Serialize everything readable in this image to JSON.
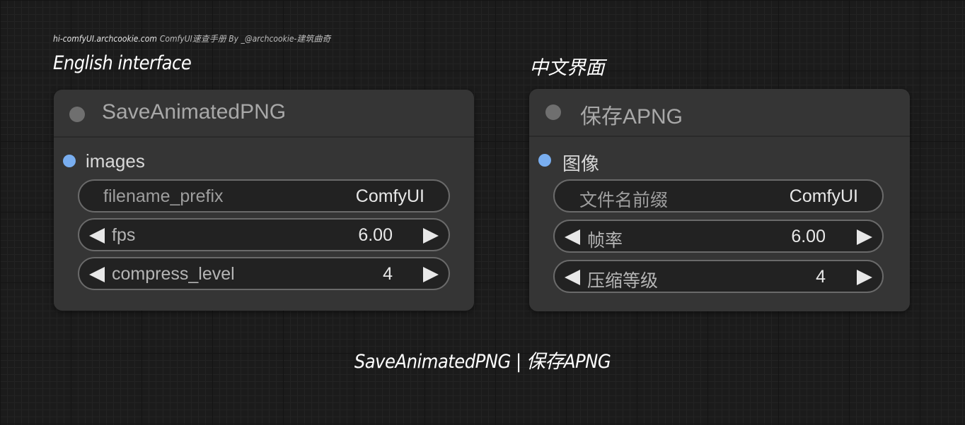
{
  "watermark": {
    "domain": "hi-comfyUI.archcookie.com",
    "text": "ComfyUI速查手册 By _@archcookie-建筑曲奇"
  },
  "sections": {
    "english_label": "English interface",
    "chinese_label": "中文界面"
  },
  "nodes": [
    {
      "title": "SaveAnimatedPNG",
      "input_label": "images",
      "widgets": [
        {
          "label": "filename_prefix",
          "value": "ComfyUI"
        },
        {
          "label": "fps",
          "value": "6.00"
        },
        {
          "label": "compress_level",
          "value": "4"
        }
      ]
    },
    {
      "title": "保存APNG",
      "input_label": "图像",
      "widgets": [
        {
          "label": "文件名前缀",
          "value": "ComfyUI"
        },
        {
          "label": "帧率",
          "value": "6.00"
        },
        {
          "label": "压缩等级",
          "value": "4"
        }
      ]
    }
  ],
  "footer": "SaveAnimatedPNG | 保存APNG",
  "colors": {
    "canvas_background": "#1b1b1b",
    "node_background": "#353535",
    "input_dot": "#79aef0",
    "widget_border": "#6a6a6a",
    "title_text": "#a8a8a8"
  }
}
